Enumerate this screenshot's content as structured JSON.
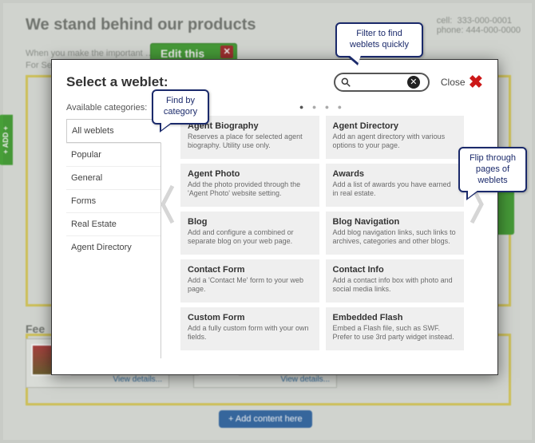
{
  "background": {
    "headline": "We stand behind our products",
    "edit_label": "Edit this",
    "add_tab": "+ ADD +",
    "feed_title": "Fee",
    "view_details": "View details...",
    "add_content": "+ Add content here",
    "contact_cell_label": "cell:",
    "contact_cell_value": "333-000-0001",
    "contact_phone_label": "phone:",
    "contact_phone_value": "444-000-0000"
  },
  "modal": {
    "title": "Select a weblet:",
    "close_label": "Close",
    "search": {
      "placeholder": ""
    },
    "sidebar_title": "Available categories:",
    "categories": [
      {
        "label": "All weblets",
        "active": true
      },
      {
        "label": "Popular"
      },
      {
        "label": "General"
      },
      {
        "label": "Forms"
      },
      {
        "label": "Real Estate"
      },
      {
        "label": "Agent Directory"
      }
    ],
    "tiles": [
      {
        "title": "Agent Biography",
        "desc": "Reserves a place for selected agent biography. Utility use only."
      },
      {
        "title": "Agent Directory",
        "desc": "Add an agent directory with various options to your page."
      },
      {
        "title": "Agent Photo",
        "desc": "Add the photo provided through the 'Agent Photo' website setting."
      },
      {
        "title": "Awards",
        "desc": "Add a list of awards you have earned in real estate."
      },
      {
        "title": "Blog",
        "desc": "Add and configure a combined or separate blog on your web page."
      },
      {
        "title": "Blog Navigation",
        "desc": "Add blog navigation links, such links to archives, categories and other blogs."
      },
      {
        "title": "Contact Form",
        "desc": "Add a 'Contact Me' form to your web page."
      },
      {
        "title": "Contact Info",
        "desc": "Add a contact info box with photo and social media links."
      },
      {
        "title": "Custom Form",
        "desc": "Add a fully custom form with your own fields."
      },
      {
        "title": "Embedded Flash",
        "desc": "Embed a Flash file, such as SWF. Prefer to use 3rd party widget instead."
      }
    ]
  },
  "callouts": {
    "filter": "Filter to find weblets quickly",
    "category": "Find by category",
    "flip": "Flip through pages of weblets"
  }
}
